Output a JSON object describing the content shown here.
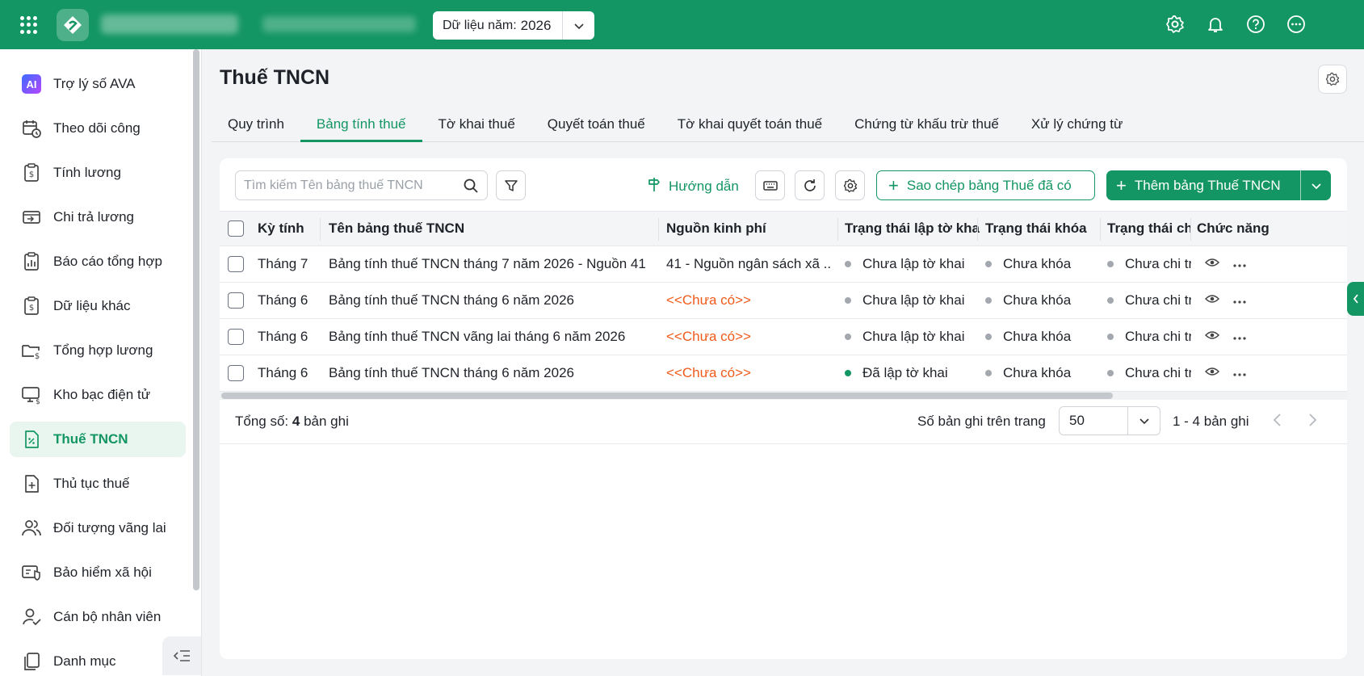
{
  "topbar": {
    "year_label": "Dữ liệu năm:",
    "year_value": "2026"
  },
  "sidebar": {
    "items": [
      {
        "label": "Trợ lý số AVA",
        "icon": "ai-assistant-icon",
        "badge": "AI"
      },
      {
        "label": "Theo dõi công",
        "icon": "calendar-clock-icon"
      },
      {
        "label": "Tính lương",
        "icon": "salary-calc-icon"
      },
      {
        "label": "Chi trả lương",
        "icon": "payment-icon"
      },
      {
        "label": "Báo cáo tổng hợp",
        "icon": "report-icon"
      },
      {
        "label": "Dữ liệu khác",
        "icon": "data-icon"
      },
      {
        "label": "Tổng hợp lương",
        "icon": "folder-money-icon"
      },
      {
        "label": "Kho bạc điện tử",
        "icon": "treasury-icon"
      },
      {
        "label": "Thuế TNCN",
        "icon": "tax-icon",
        "active": true
      },
      {
        "label": "Thủ tục thuế",
        "icon": "tax-procedure-icon"
      },
      {
        "label": "Đối tượng vãng lai",
        "icon": "users-icon"
      },
      {
        "label": "Bảo hiểm xã hội",
        "icon": "insurance-icon"
      },
      {
        "label": "Cán bộ nhân viên",
        "icon": "user-check-icon"
      },
      {
        "label": "Danh mục",
        "icon": "catalog-icon"
      }
    ]
  },
  "main": {
    "title": "Thuế TNCN",
    "tabs": [
      {
        "label": "Quy trình"
      },
      {
        "label": "Bảng tính thuế",
        "active": true
      },
      {
        "label": "Tờ khai thuế"
      },
      {
        "label": "Quyết toán thuế"
      },
      {
        "label": "Tờ khai quyết toán thuế"
      },
      {
        "label": "Chứng từ khấu trừ thuế"
      },
      {
        "label": "Xử lý chứng từ"
      }
    ],
    "toolbar": {
      "search_placeholder": "Tìm kiếm Tên bảng thuế TNCN",
      "guide_label": "Hướng dẫn",
      "copy_label": "Sao chép bảng Thuế đã có",
      "add_label": "Thêm bảng Thuế TNCN"
    },
    "table": {
      "headers": [
        "Kỳ tính",
        "Tên bảng thuế TNCN",
        "Nguồn kinh phí",
        "Trạng thái lập tờ khai",
        "Trạng thái khóa",
        "Trạng thái chi",
        "Chức năng"
      ],
      "rows": [
        {
          "period": "Tháng 7",
          "name": "Bảng tính thuế TNCN tháng 7 năm 2026 - Nguồn 41",
          "source": "41 - Nguồn ngân sách xã ...",
          "source_missing": false,
          "decl_status": "Chưa lập tờ khai",
          "decl_done": false,
          "lock_status": "Chưa khóa",
          "pay_status": "Chưa chi trả"
        },
        {
          "period": "Tháng 6",
          "name": "Bảng tính thuế TNCN tháng 6 năm 2026",
          "source": "<<Chưa có>>",
          "source_missing": true,
          "decl_status": "Chưa lập tờ khai",
          "decl_done": false,
          "lock_status": "Chưa khóa",
          "pay_status": "Chưa chi trả"
        },
        {
          "period": "Tháng 6",
          "name": "Bảng tính thuế TNCN vãng lai tháng 6 năm 2026",
          "source": "<<Chưa có>>",
          "source_missing": true,
          "decl_status": "Chưa lập tờ khai",
          "decl_done": false,
          "lock_status": "Chưa khóa",
          "pay_status": "Chưa chi trả"
        },
        {
          "period": "Tháng 6",
          "name": "Bảng tính thuế TNCN tháng 6 năm 2026",
          "source": "<<Chưa có>>",
          "source_missing": true,
          "decl_status": "Đã lập tờ khai",
          "decl_done": true,
          "lock_status": "Chưa khóa",
          "pay_status": "Chưa chi trả"
        }
      ]
    },
    "footer": {
      "total_label": "Tổng số:",
      "total_value": "4",
      "total_suffix": "bản ghi",
      "per_page_label": "Số bản ghi trên trang",
      "per_page_value": "50",
      "range": "1 - 4 bản ghi"
    }
  },
  "colors": {
    "brand": "#139663",
    "missing": "#f05a1a",
    "status_default": "#a3a8af"
  }
}
